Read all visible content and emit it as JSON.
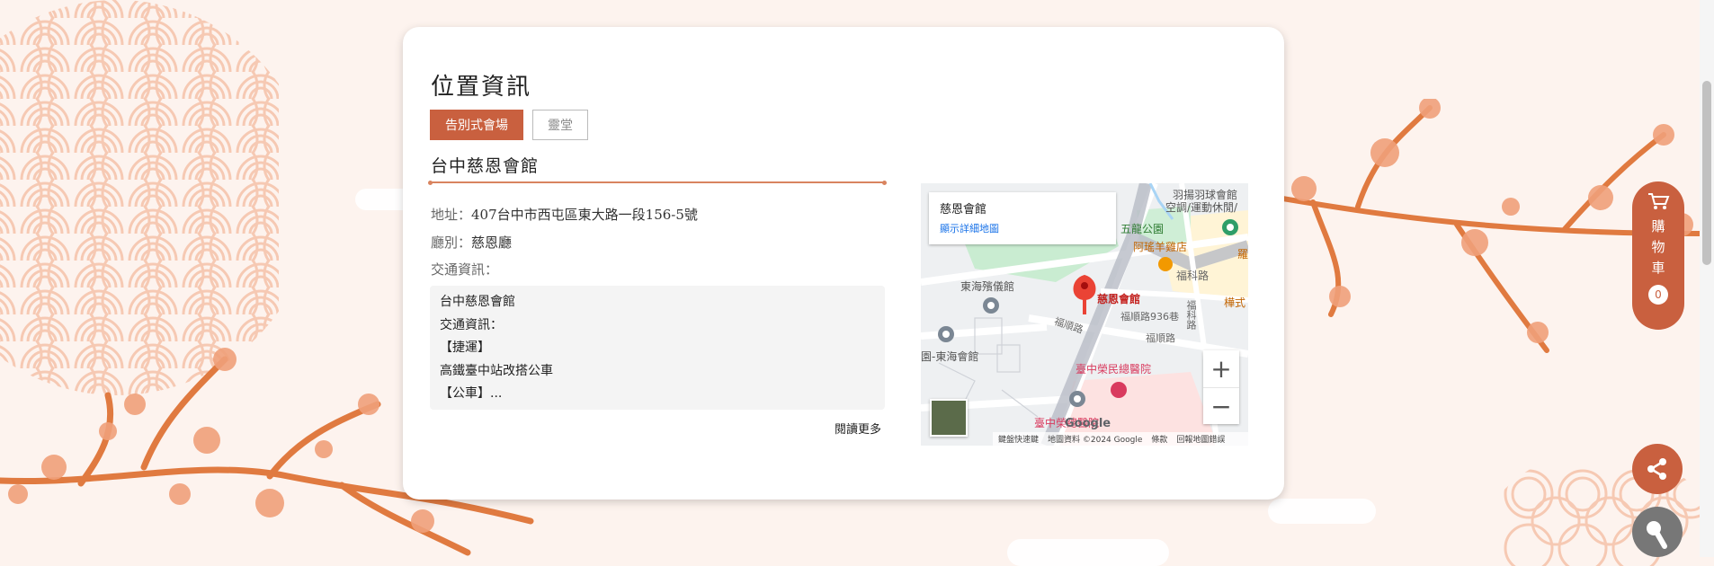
{
  "section_title": "位置資訊",
  "tabs": [
    {
      "label": "告別式會場",
      "active": true
    },
    {
      "label": "靈堂",
      "active": false
    }
  ],
  "venue": {
    "name": "台中慈恩會館",
    "address_label": "地址：",
    "address": "407台中市西屯區東大路一段156-5號",
    "hall_label": "廳別：",
    "hall": "慈恩廳",
    "traffic_label": "交通資訊：",
    "traffic_lines": [
      "台中慈恩會館",
      "交通資訊：",
      "【捷運】",
      "高鐵臺中站改搭公車",
      "【公車】..."
    ],
    "read_more": "閱讀更多"
  },
  "map": {
    "place_name": "慈恩會館",
    "view_larger": "顯示詳細地圖",
    "labels": {
      "badminton": "羽揚羽球會館",
      "sports": "空調/運動休閒/",
      "park": "五龍公園",
      "restaurant": "阿瑤羊雞店",
      "fuke": "福科路",
      "funeral": "東海殯儀館",
      "pin": "慈恩會館",
      "lane": "福順路936巷",
      "shun1": "福順路",
      "shun2": "福順路",
      "hall": "園-東海會館",
      "hospital": "臺中榮民總醫院",
      "hospital2": "臺中榮總醫院",
      "edge1": "羅",
      "edge2": "樺式",
      "vroad": "福科路"
    },
    "zoom_in": "+",
    "zoom_out": "−",
    "footer": [
      "鍵盤快速鍵",
      "地圖資料 ©2024 Google",
      "條款",
      "回報地圖錯誤"
    ],
    "google": "Google"
  },
  "arrows": {
    "prev": "‹",
    "next": "›"
  },
  "cart": {
    "label": "購物車",
    "count": "0"
  },
  "colors": {
    "accent": "#c9603f",
    "background": "#fdf3ee"
  }
}
